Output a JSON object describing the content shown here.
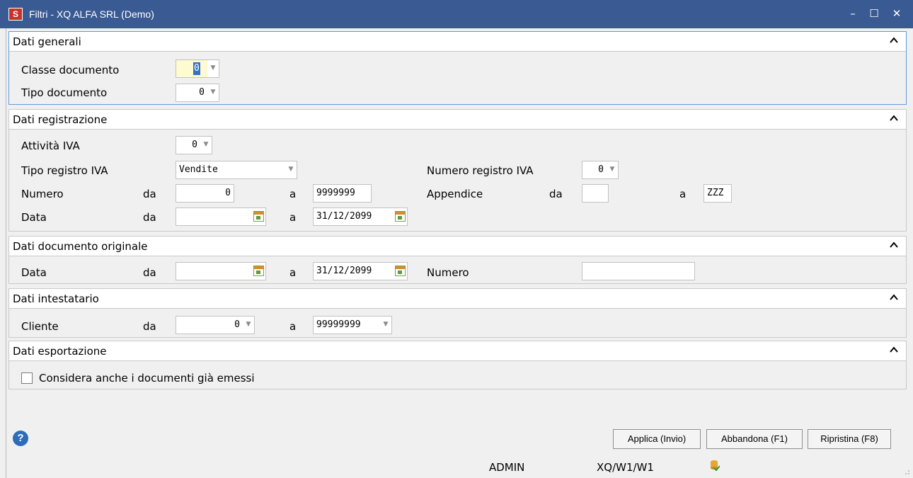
{
  "window": {
    "title": "Filtri - XQ ALFA SRL  (Demo)",
    "app_icon_text": "S",
    "minimize": "–",
    "maximize": "☐",
    "close": "✕"
  },
  "sections": {
    "generali": {
      "title": "Dati generali",
      "classe_label": "Classe documento",
      "classe_value": "0",
      "tipo_label": "Tipo documento",
      "tipo_value": "0"
    },
    "registrazione": {
      "title": "Dati registrazione",
      "attivita_label": "Attività IVA",
      "attivita_value": "0",
      "tipo_registro_label": "Tipo registro IVA",
      "tipo_registro_value": "Vendite",
      "numero_registro_label": "Numero registro IVA",
      "numero_registro_value": "0",
      "numero_label": "Numero",
      "da": "da",
      "a": "a",
      "numero_da": "0",
      "numero_a": "9999999",
      "appendice_label": "Appendice",
      "appendice_da": "",
      "appendice_a": "ZZZ",
      "data_label": "Data",
      "data_da": "",
      "data_a": "31/12/2099"
    },
    "originale": {
      "title": "Dati documento originale",
      "data_label": "Data",
      "da": "da",
      "a": "a",
      "data_da": "",
      "data_a": "31/12/2099",
      "numero_label": "Numero",
      "numero_value": ""
    },
    "intestatario": {
      "title": "Dati intestatario",
      "cliente_label": "Cliente",
      "da": "da",
      "a": "a",
      "cliente_da": "0",
      "cliente_a": "99999999"
    },
    "esportazione": {
      "title": "Dati esportazione",
      "checkbox_label": "Considera anche i documenti già emessi",
      "checked": false
    }
  },
  "buttons": {
    "applica": "Applica (Invio)",
    "abbandona": "Abbandona (F1)",
    "ripristina": "Ripristina (F8)"
  },
  "help_symbol": "?",
  "status": {
    "user": "ADMIN",
    "path": "XQ/W1/W1"
  },
  "colors": {
    "titlebar": "#3a5a94",
    "focus_field": "#fffbd0",
    "focus_border": "#5d9be0"
  }
}
